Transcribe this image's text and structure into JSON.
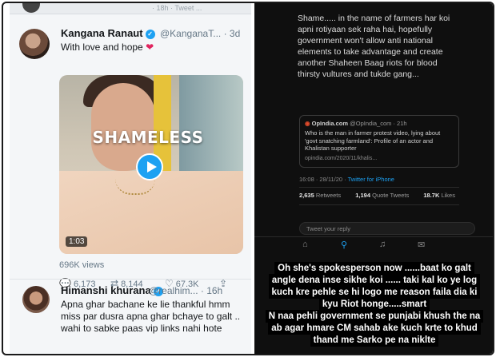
{
  "left_panel": {
    "top_strip_meta": "· 18h · Tweet ...",
    "tweet1": {
      "name": "Kangana Ranaut",
      "handle": "@KanganaT...",
      "time": "· 3d",
      "text": "With love and hope",
      "heart": "❤",
      "video_caption": "SHAMELESS",
      "duration": "1:03",
      "views": "696K views",
      "replies": "6,173",
      "retweets": "8,144",
      "likes": "67.3K"
    },
    "tweet2": {
      "name": "Himanshi khurana",
      "handle": "@realhim...",
      "time": "· 16h",
      "text": "Apna ghar bachane ke lie thankful hmm miss par dusra apna ghar bchaye to galt .. wahi to sabke paas vip links nahi hote"
    }
  },
  "right_panel": {
    "tweet_text": "Shame..... in the name of farmers har koi apni rotiyaan sek raha hai, hopefully government won't allow anti national elements to take advantage and create another Shaheen Baag riots for blood thirsty vultures and tukde gang...",
    "card": {
      "source_name": "OpIndia.com",
      "source_handle": "@OpIndia_com · 21h",
      "headline": "Who is the man in farmer protest video, lying about 'govt snatching farmland': Profile of an actor and Khalistan supporter",
      "link": "opindia.com/2020/11/khalis..."
    },
    "timestamp": "16:08 · 28/11/20 · ",
    "timestamp_client": "Twitter for iPhone",
    "stats": {
      "retweets_count": "2,635",
      "retweets_label": "Retweets",
      "quotes_count": "1,194",
      "quotes_label": "Quote Tweets",
      "likes_count": "18.7K",
      "likes_label": "Likes"
    },
    "reply_placeholder": "Tweet your reply",
    "story_lines": [
      "Oh she's spokesperson now ......baat ko galt",
      "angle dena inse sikhe koi ...... taki kal ko ye log",
      "kuch kre pehle se hi logo me reason faila dia ki",
      "kyu Riot honge.....smart",
      "N naa pehli government se punjabi khush the na",
      "ab agar hmare CM sahab ake kuch krte to khud",
      "thand me Sarko pe na niklte"
    ]
  },
  "colors": {
    "twitter_blue": "#1da1f2",
    "like_red": "#e0245e",
    "dark_bg": "#0f0f0f"
  }
}
